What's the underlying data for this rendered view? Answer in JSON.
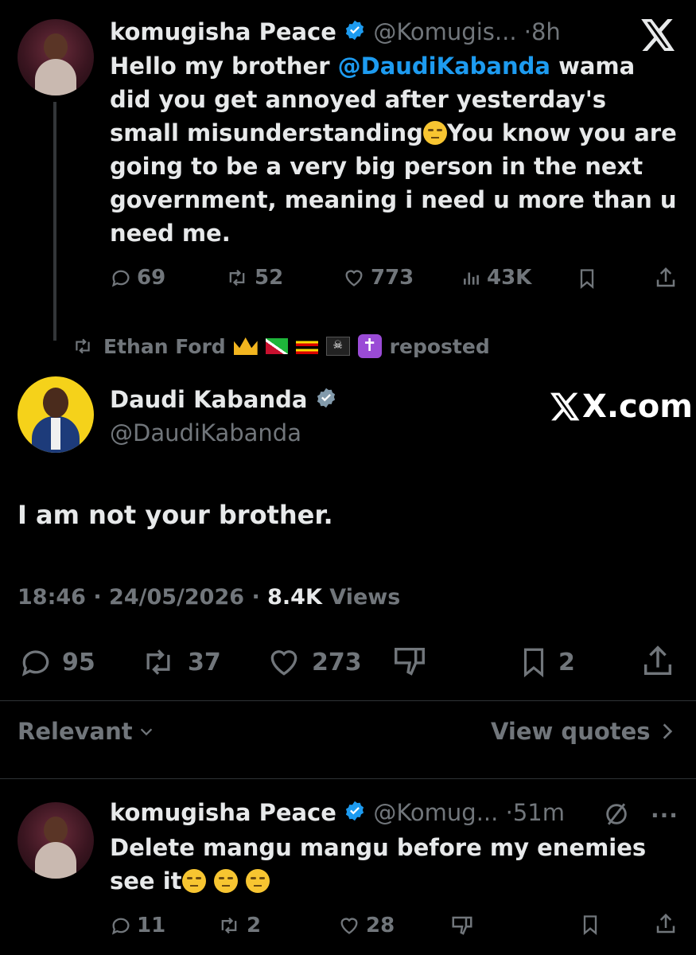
{
  "tweet1": {
    "name": "komugisha Peace",
    "handle": "@Komugis...",
    "time": "8h",
    "text_before": "Hello my brother ",
    "mention": "@DaudiKabanda",
    "text_mid": " wama did you get annoyed after yesterday's  small misunderstanding",
    "text_after": "You know you are going to be a very big person in the next government, meaning i need u more than u need me.",
    "replies": "69",
    "reposts": "52",
    "likes": "773",
    "views": "43K"
  },
  "repost": {
    "name": "Ethan Ford",
    "label": "reposted"
  },
  "main_tweet": {
    "name": "Daudi Kabanda",
    "handle": "@DaudiKabanda",
    "watermark": "X.com",
    "text": "I am not your brother.",
    "time": "18:46",
    "date": "24/05/2026",
    "views_count": "8.4K",
    "views_label": "Views",
    "replies": "95",
    "reposts": "37",
    "likes": "273",
    "bookmarks": "2"
  },
  "sort": {
    "label": "Relevant",
    "quotes_link": "View quotes"
  },
  "reply": {
    "name": "komugisha Peace",
    "handle": "@Komug...",
    "time": "51m",
    "text": "Delete mangu mangu before my enemies see it",
    "replies": "11",
    "reposts": "2",
    "likes": "28"
  },
  "colors": {
    "background": "#000000",
    "text": "#e7e9ea",
    "muted": "#71767b",
    "accent": "#1d9bf0"
  }
}
